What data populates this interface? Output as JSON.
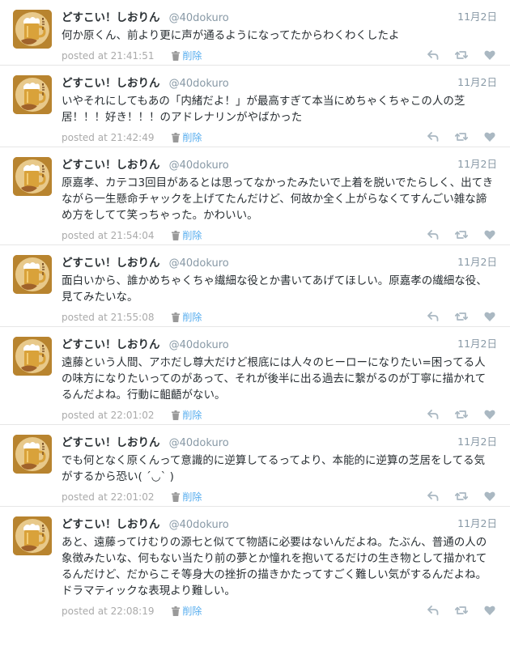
{
  "tweets": [
    {
      "name": "どすこい！しおりん",
      "screen_name": "@40dokuro",
      "date": "11月2日",
      "text": "何か原くん、前より更に声が通るようになってたからわくわくしたよ",
      "posted": "posted at 21:41:51",
      "delete_label": "削除"
    },
    {
      "name": "どすこい！しおりん",
      "screen_name": "@40dokuro",
      "date": "11月2日",
      "text": "いやそれにしてもあの「内緒だよ！」が最高すぎて本当にめちゃくちゃこの人の芝居！！！好き！！！のアドレナリンがやばかった",
      "posted": "posted at 21:42:49",
      "delete_label": "削除"
    },
    {
      "name": "どすこい！しおりん",
      "screen_name": "@40dokuro",
      "date": "11月2日",
      "text": "原嘉孝、カテコ3回目があるとは思ってなかったみたいで上着を脱いでたらしく、出てきながら一生懸命チャックを上げてたんだけど、何故か全く上がらなくてすんごい雑な諦め方をしてて笑っちゃった。かわいい。",
      "posted": "posted at 21:54:04",
      "delete_label": "削除"
    },
    {
      "name": "どすこい！しおりん",
      "screen_name": "@40dokuro",
      "date": "11月2日",
      "text": "面白いから、誰かめちゃくちゃ繊細な役とか書いてあげてほしい。原嘉孝の繊細な役、見てみたいな。",
      "posted": "posted at 21:55:08",
      "delete_label": "削除"
    },
    {
      "name": "どすこい！しおりん",
      "screen_name": "@40dokuro",
      "date": "11月2日",
      "text": "遠藤という人間、アホだし尊大だけど根底には人々のヒーローになりたい=困ってる人の味方になりたいってのがあって、それが後半に出る過去に繋がるのが丁寧に描かれてるんだよね。行動に齟齬がない。",
      "posted": "posted at 22:01:02",
      "delete_label": "削除"
    },
    {
      "name": "どすこい！しおりん",
      "screen_name": "@40dokuro",
      "date": "11月2日",
      "text": "でも何となく原くんって意識的に逆算してるってより、本能的に逆算の芝居をしてる気がするから恐い( ´◡` )",
      "posted": "posted at 22:01:02",
      "delete_label": "削除"
    },
    {
      "name": "どすこい！しおりん",
      "screen_name": "@40dokuro",
      "date": "11月2日",
      "text": "あと、遠藤ってけむりの源七と似てて物語に必要はないんだよね。たぶん、普通の人の象徴みたいな、何もない当たり前の夢とか憧れを抱いてるだけの生き物として描かれてるんだけど、だからこそ等身大の挫折の描きかたってすごく難しい気がするんだよね。ドラマティックな表現より難しい。",
      "posted": "posted at 22:08:19",
      "delete_label": "削除"
    }
  ],
  "icons": {
    "avatar": "beer-mug-avatar",
    "delete": "trash-icon",
    "reply": "reply-icon",
    "retweet": "retweet-icon",
    "like": "heart-icon"
  },
  "colors": {
    "link": "#55acee",
    "muted": "#aaaaaa",
    "action_icons": "#aab8c2",
    "divider": "#e6e6e6"
  }
}
